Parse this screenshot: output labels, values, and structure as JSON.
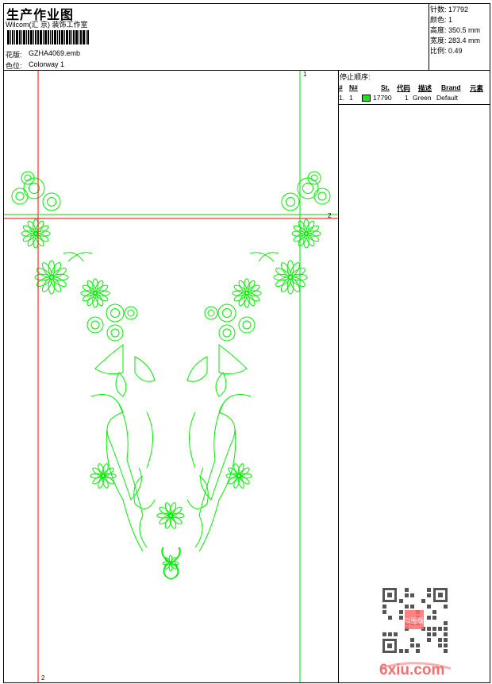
{
  "header": {
    "title": "生产作业图",
    "subtitle": "Wilcom(汇 京) 装饰工作室",
    "design_label": "花版:",
    "design_value": "GZHA4069.emb",
    "colorway_label": "色位:",
    "colorway_value": "Colorway 1"
  },
  "stats": [
    {
      "label": "针数:",
      "value": "17792"
    },
    {
      "label": "颜色:",
      "value": "1"
    },
    {
      "label": "高度:",
      "value": "350.5 mm"
    },
    {
      "label": "宽度:",
      "value": "283.4 mm"
    },
    {
      "label": "比例:",
      "value": "0.49"
    }
  ],
  "stop_sequence": {
    "title": "停止顺序:",
    "columns": [
      "#",
      "N#",
      "St.",
      "代码",
      "描述",
      "Brand",
      "元素"
    ],
    "rows": [
      {
        "index": "1.",
        "n": "1",
        "color": "#22dd22",
        "stitches": "17790",
        "code": "1",
        "description": "Green",
        "brand": "Default",
        "element": ""
      }
    ]
  },
  "guides": {
    "green_top": "1",
    "red_bottom": "2",
    "red_right": "2"
  },
  "watermark": {
    "site": "6xiu.com",
    "stamp": "以图版"
  },
  "colors": {
    "thread": "#00ee00",
    "red_guide": "#ff0000",
    "green_guide": "#00dd00"
  }
}
